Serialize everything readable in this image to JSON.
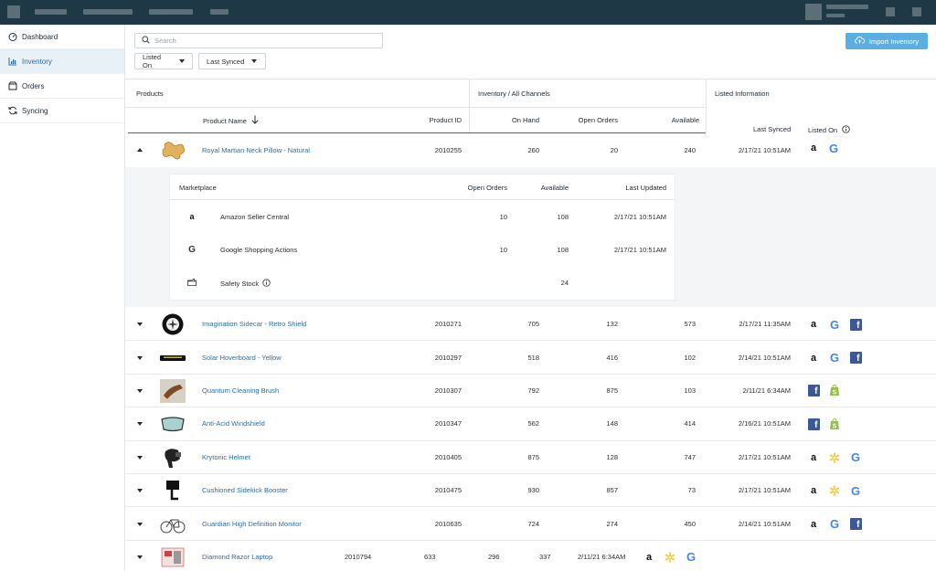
{
  "sidebar": {
    "items": [
      {
        "label": "Dashboard",
        "icon": "dashboard-icon",
        "active": false
      },
      {
        "label": "Inventory",
        "icon": "chart-icon",
        "active": true
      },
      {
        "label": "Orders",
        "icon": "box-icon",
        "active": false
      },
      {
        "label": "Syncing",
        "icon": "sync-icon",
        "active": false
      }
    ]
  },
  "toolbar": {
    "search_placeholder": "Search",
    "listed_on_label": "Listed On",
    "last_synced_label": "Last Synced",
    "import_label": "Import Inventory"
  },
  "table": {
    "groups": {
      "products": "Products",
      "inventory": "Inventory / All Channels",
      "listed": "Listed Information"
    },
    "columns": {
      "product_name": "Product Name",
      "product_id": "Product ID",
      "on_hand": "On Hand",
      "open_orders": "Open Orders",
      "available": "Available",
      "last_synced": "Last Synced",
      "listed_on": "Listed On"
    },
    "expanded": {
      "name": "Royal Martian Neck Pillow - Natural",
      "id": "2010255",
      "on_hand": "260",
      "open_orders": "20",
      "available": "240",
      "last_synced": "2/17/21 10:51AM"
    },
    "detail": {
      "headers": {
        "marketplace": "Marketplace",
        "open_orders": "Open Orders",
        "available": "Available",
        "last_updated": "Last Updated"
      },
      "rows": [
        {
          "name": "Amazon Seller Central",
          "open_orders": "10",
          "available": "108",
          "last_updated": "2/17/21 10:51AM"
        },
        {
          "name": "Google Shopping Actions",
          "open_orders": "10",
          "available": "108",
          "last_updated": "2/17/21 10:51AM"
        },
        {
          "name": "Safety Stock",
          "open_orders": "",
          "available": "24",
          "last_updated": ""
        }
      ]
    },
    "rows": [
      {
        "name": "Imagination Sidecar - Retro Shield",
        "id": "2010271",
        "on_hand": "705",
        "open_orders": "132",
        "available": "573",
        "last_synced": "2/17/21 11:35AM"
      },
      {
        "name": "Solar Hoverboard - Yellow",
        "id": "2010297",
        "on_hand": "518",
        "open_orders": "416",
        "available": "102",
        "last_synced": "2/14/21 10:51AM"
      },
      {
        "name": "Quantum Cleaning Brush",
        "id": "2010307",
        "on_hand": "792",
        "open_orders": "875",
        "available": "103",
        "last_synced": "2/11/21 6:34AM"
      },
      {
        "name": "Anti-Acid Windshield",
        "id": "2010347",
        "on_hand": "562",
        "open_orders": "148",
        "available": "414",
        "last_synced": "2/16/21 10:51AM"
      },
      {
        "name": "Krytonic Helmet",
        "id": "2010405",
        "on_hand": "875",
        "open_orders": "128",
        "available": "747",
        "last_synced": "2/17/21 10:51AM"
      },
      {
        "name": "Cushioned Sidekick Booster",
        "id": "2010475",
        "on_hand": "930",
        "open_orders": "857",
        "available": "73",
        "last_synced": "2/17/21 10:51AM"
      },
      {
        "name": "Guardian High Definition Monitor",
        "id": "2010635",
        "on_hand": "724",
        "open_orders": "274",
        "available": "450",
        "last_synced": "2/14/21 10:51AM"
      },
      {
        "name": "Diamond Razor Laptop",
        "id": "2010794",
        "on_hand": "633",
        "open_orders": "296",
        "available": "337",
        "last_synced": "2/11/21 6:34AM"
      }
    ]
  },
  "colors": {
    "topbar": "#1f3845",
    "accent": "#2a6fa8",
    "import_button": "#5aaee2",
    "facebook": "#3b5998",
    "shopify": "#95bf47",
    "walmart": "#ffc220"
  }
}
